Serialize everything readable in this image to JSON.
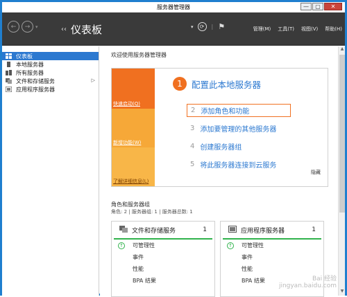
{
  "window": {
    "title": "服务器管理器",
    "buttons": {
      "minimize": "—",
      "maximize": "▢",
      "close": "✕"
    }
  },
  "header": {
    "title": "仪表板",
    "breadcrumb_marker": "‹‹",
    "menu": [
      "管理(M)",
      "工具(T)",
      "视图(V)",
      "帮助(H)"
    ]
  },
  "sidebar": {
    "items": [
      {
        "label": "仪表板",
        "icon": "dashboard-icon"
      },
      {
        "label": "本地服务器",
        "icon": "server-icon"
      },
      {
        "label": "所有服务器",
        "icon": "servers-icon"
      },
      {
        "label": "文件和存储服务",
        "icon": "storage-icon"
      },
      {
        "label": "应用程序服务器",
        "icon": "app-server-icon"
      }
    ]
  },
  "main": {
    "welcome": "欢迎使用服务器管理器",
    "quickstart": {
      "tiles": [
        "快速启动(Q)",
        "新增功能(W)",
        "了解详细信息(L)"
      ],
      "step1": {
        "num": "1",
        "label": "配置此本地服务器"
      },
      "steps": [
        {
          "num": "2",
          "label": "添加角色和功能"
        },
        {
          "num": "3",
          "label": "添加要管理的其他服务器"
        },
        {
          "num": "4",
          "label": "创建服务器组"
        },
        {
          "num": "5",
          "label": "将此服务器连接到云服务"
        }
      ],
      "hide": "隐藏"
    },
    "roles": {
      "title": "角色和服务器组",
      "subtitle": "角色: 2 | 服务器组: 1 | 服务器总数: 1",
      "cards": [
        {
          "title": "文件和存储服务",
          "count": "1",
          "rows": [
            "可管理性",
            "事件",
            "性能",
            "BPA 结果"
          ]
        },
        {
          "title": "应用程序服务器",
          "count": "1",
          "rows": [
            "可管理性",
            "事件",
            "性能",
            "BPA 结果"
          ]
        }
      ]
    }
  },
  "watermark": "Bai 经验\njingyan.baidu.com",
  "colors": {
    "accent": "#2b78d0",
    "orange": "#f07020",
    "green": "#2fb24b",
    "header": "#3a3a3a"
  }
}
